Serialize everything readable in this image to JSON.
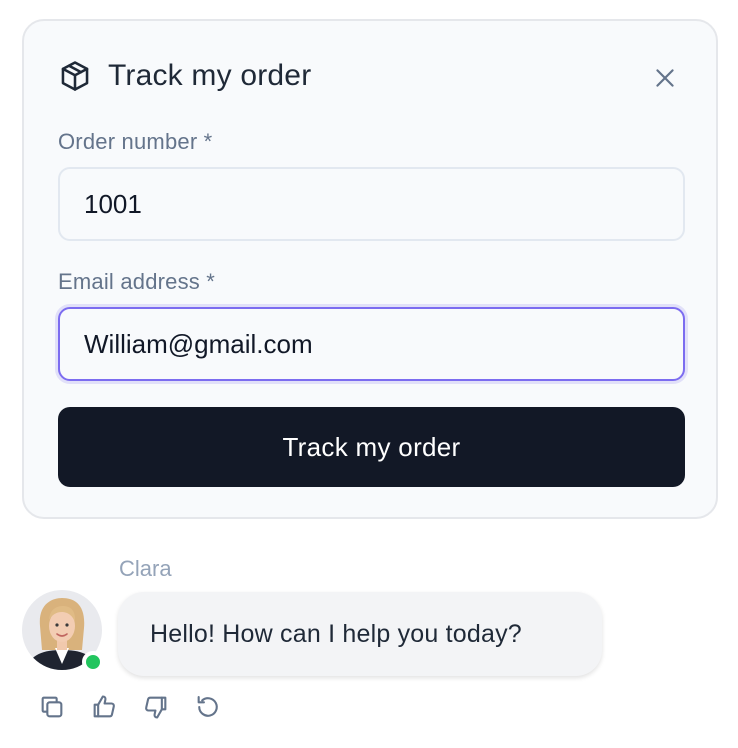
{
  "card": {
    "title": "Track my order",
    "icon": "package-icon",
    "close_icon": "close-icon"
  },
  "form": {
    "order_number_label": "Order number *",
    "order_number_value": "1001",
    "email_label": "Email address *",
    "email_value": "William@gmail.com",
    "submit_label": "Track my order"
  },
  "chat": {
    "agent_name": "Clara",
    "agent_status": "online",
    "message": "Hello! How can I help you today?",
    "actions": [
      "copy-icon",
      "thumbs-up-icon",
      "thumbs-down-icon",
      "regenerate-icon"
    ]
  },
  "colors": {
    "button_bg": "#121826",
    "focus_ring": "#7c6cf0",
    "online": "#22c55e",
    "label": "#64748b"
  }
}
